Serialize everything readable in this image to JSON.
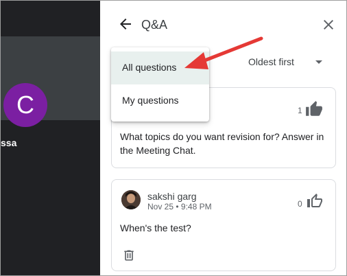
{
  "meeting": {
    "avatar_letter": "C",
    "participant_name_fragment": "ssa"
  },
  "panel": {
    "title": "Q&A",
    "sort_label": "Oldest first"
  },
  "filter_menu": {
    "items": [
      {
        "label": "All questions",
        "selected": true
      },
      {
        "label": "My questions",
        "selected": false
      }
    ]
  },
  "questions": [
    {
      "text": "What topics do you want revision for? Answer in the Meeting Chat.",
      "text_line1": "What topics do you want revision for? Answer in",
      "text_line2": "the Meeting Chat.",
      "likes": "1",
      "liked": true
    },
    {
      "author": "sakshi garg",
      "time": "Nov 25 • 9:48 PM",
      "text": "When's the test?",
      "likes": "0",
      "liked": false
    }
  ],
  "colors": {
    "accent_arrow": "#e53935",
    "avatar_bg": "#7b1fa2",
    "dropdown_selected": "#e8f0ee",
    "meeting_bg": "#202124"
  },
  "icons": {
    "back": "arrow-back-icon",
    "close": "close-icon",
    "thumb_up_filled": "thumb-up-filled-icon",
    "thumb_up_outline": "thumb-up-outline-icon",
    "delete": "trash-icon",
    "sort": "caret-down-icon"
  }
}
